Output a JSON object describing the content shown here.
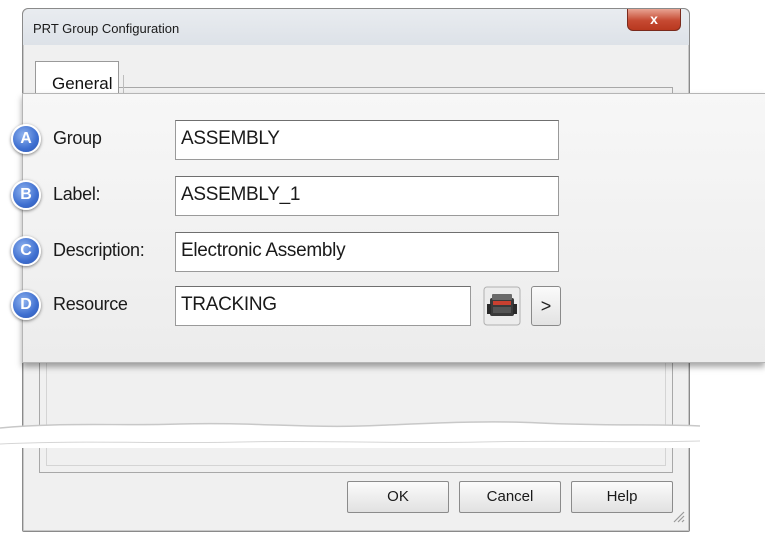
{
  "window": {
    "title": "PRT Group Configuration",
    "close_label": "x"
  },
  "tabs": [
    {
      "label": "General"
    }
  ],
  "fields": [
    {
      "badge": "A",
      "label": "Group",
      "value": "ASSEMBLY"
    },
    {
      "badge": "B",
      "label": "Label:",
      "value": "ASSEMBLY_1"
    },
    {
      "badge": "C",
      "label": "Description:",
      "value": "Electronic Assembly"
    },
    {
      "badge": "D",
      "label": "Resource",
      "value": "TRACKING",
      "arrow_label": ">"
    }
  ],
  "buttons": {
    "ok": "OK",
    "cancel": "Cancel",
    "help": "Help"
  },
  "icons": {
    "close": "close-icon",
    "resource": "resource-picker-icon",
    "grip": "resize-grip-icon"
  },
  "colors": {
    "badge": "#3e6fd0",
    "close": "#c64a32"
  }
}
